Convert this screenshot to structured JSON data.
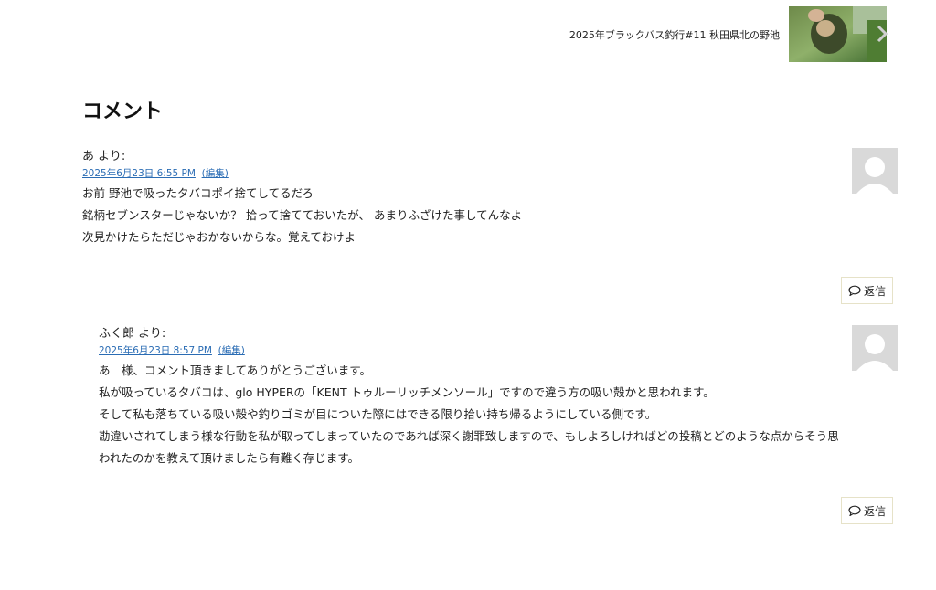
{
  "next_post": {
    "title": "2025年ブラックバス釣行#11 秋田県北の野池"
  },
  "comments_heading": "コメント",
  "comments": [
    {
      "author": "あ より:",
      "date": "2025年6月23日 6:55 PM",
      "edit_label": "(編集)",
      "lines": [
        "お前 野池で吸ったタバコポイ捨てしてるだろ",
        "銘柄セブンスターじゃないか？ 拾って捨てておいたが、 あまりふざけた事してんなよ",
        "次見かけたらただじゃおかないからな。覚えておけよ"
      ],
      "reply_label": "返信"
    },
    {
      "author": "ふく郎 より:",
      "date": "2025年6月23日 8:57 PM",
      "edit_label": "(編集)",
      "lines": [
        "あ　様、コメント頂きましてありがとうございます。",
        "私が吸っているタバコは、glo HYPERの「KENT トゥルーリッチメンソール」ですので違う方の吸い殻かと思われます。",
        "そして私も落ちている吸い殻や釣りゴミが目についた際にはできる限り拾い持ち帰るようにしている側です。",
        "勘違いされてしまう様な行動を私が取ってしまっていたのであれば深く謝罪致しますので、もしよろしければどの投稿とどのような点からそう思",
        "われたのかを教えて頂けましたら有難く存じます。"
      ],
      "reply_label": "返信"
    }
  ],
  "colors": {
    "link": "#2a6cb4",
    "avatar_bg": "#d9d9d9",
    "reply_border": "#e6e2c8"
  }
}
